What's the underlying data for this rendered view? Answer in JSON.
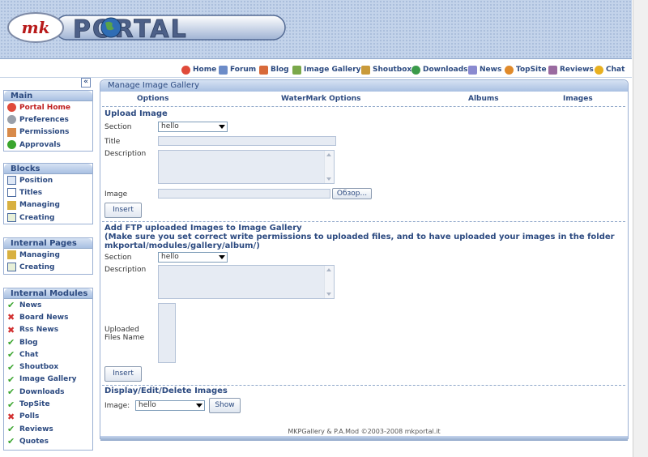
{
  "logo": {
    "brand_left": "mk",
    "brand_right": "PORTAL"
  },
  "nav": [
    {
      "label": "Home",
      "icon": "home-icon"
    },
    {
      "label": "Forum",
      "icon": "forum-icon"
    },
    {
      "label": "Blog",
      "icon": "blog-icon"
    },
    {
      "label": "Image Gallery",
      "icon": "gallery-icon"
    },
    {
      "label": "Shoutbox",
      "icon": "shoutbox-icon"
    },
    {
      "label": "Downloads",
      "icon": "downloads-icon"
    },
    {
      "label": "News",
      "icon": "news-icon"
    },
    {
      "label": "TopSite",
      "icon": "topsite-icon"
    },
    {
      "label": "Reviews",
      "icon": "reviews-icon"
    },
    {
      "label": "Chat",
      "icon": "chat-icon"
    }
  ],
  "sidebar": {
    "collapse_label": "«",
    "main": {
      "title": "Main",
      "items": [
        "Portal Home",
        "Preferences",
        "Permissions",
        "Approvals"
      ]
    },
    "blocks": {
      "title": "Blocks",
      "items": [
        "Position",
        "Titles",
        "Managing",
        "Creating"
      ]
    },
    "internal_pages": {
      "title": "Internal Pages",
      "items": [
        "Managing",
        "Creating"
      ]
    },
    "internal_modules": {
      "title": "Internal Modules",
      "items": [
        {
          "label": "News",
          "status": "enabled"
        },
        {
          "label": "Board News",
          "status": "disabled"
        },
        {
          "label": "Rss News",
          "status": "disabled"
        },
        {
          "label": "Blog",
          "status": "enabled"
        },
        {
          "label": "Chat",
          "status": "enabled"
        },
        {
          "label": "Shoutbox",
          "status": "enabled"
        },
        {
          "label": "Image Gallery",
          "status": "enabled"
        },
        {
          "label": "Downloads",
          "status": "enabled"
        },
        {
          "label": "TopSite",
          "status": "enabled"
        },
        {
          "label": "Polls",
          "status": "disabled"
        },
        {
          "label": "Reviews",
          "status": "enabled"
        },
        {
          "label": "Quotes",
          "status": "enabled"
        }
      ]
    }
  },
  "main": {
    "title": "Manage Image Gallery",
    "tabs": [
      "Options",
      "WaterMark Options",
      "Albums",
      "Images"
    ],
    "upload": {
      "heading": "Upload Image",
      "section_label": "Section",
      "section_value": "hello",
      "title_label": "Title",
      "description_label": "Description",
      "image_label": "Image",
      "browse_label": "Обзор...",
      "insert_label": "Insert"
    },
    "ftp": {
      "heading_line1": "Add FTP uploaded Images to Image Gallery",
      "heading_line2": "(Make sure you set correct write permissions to uploaded files, and to have uploaded your images in the folder",
      "heading_line3": "mkportal/modules/gallery/album/)",
      "section_label": "Section",
      "section_value": "hello",
      "description_label": "Description",
      "files_label_1": "Uploaded",
      "files_label_2": "Files Name",
      "insert_label": "Insert"
    },
    "display": {
      "heading": "Display/Edit/Delete Images",
      "image_label": "Image:",
      "image_value": "hello",
      "show_label": "Show"
    },
    "footer": "MKPGallery & P.A.Mod ©2003-2008 mkportal.it"
  },
  "colors": {
    "accent": "#2c4a80",
    "active": "#c02020",
    "enabled": "#3aa52e",
    "disabled": "#d23030"
  }
}
